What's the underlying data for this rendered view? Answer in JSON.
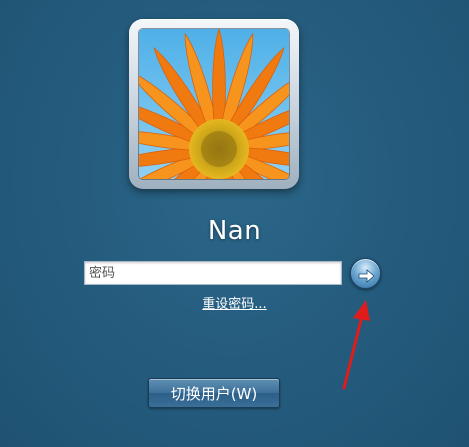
{
  "user": {
    "name": "Nan",
    "avatar": "orange-gerbera-flower"
  },
  "password": {
    "placeholder": "密码",
    "value": ""
  },
  "submit": {
    "icon": "arrow-right-icon"
  },
  "reset_link": {
    "label": "重设密码..."
  },
  "switch_user": {
    "label": "切换用户(W)"
  },
  "annotation": {
    "color": "#e01b1b"
  },
  "colors": {
    "background": "#245b7d",
    "button": "#3e729b"
  }
}
